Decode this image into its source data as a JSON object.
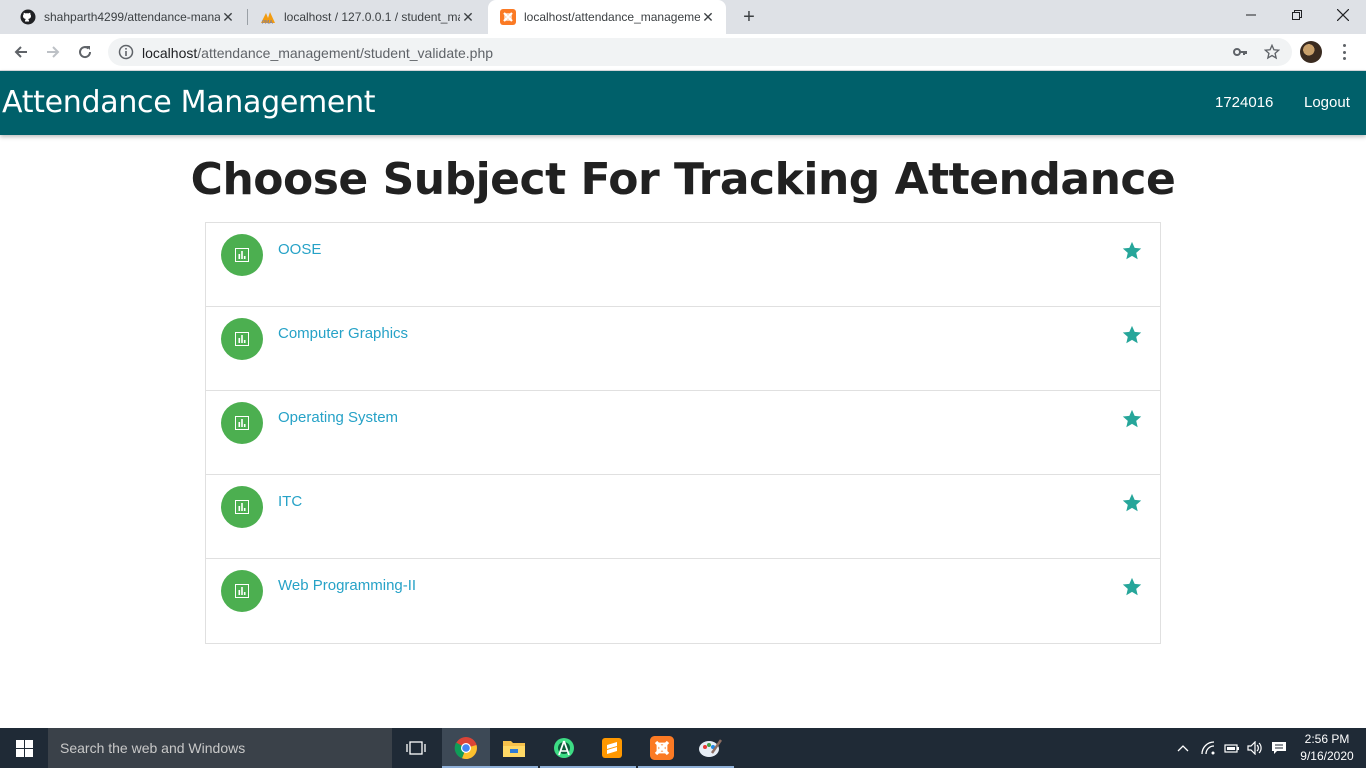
{
  "browser": {
    "tabs": [
      {
        "title": "shahparth4299/attendance-mana",
        "icon": "github-icon"
      },
      {
        "title": "localhost / 127.0.0.1 / student_ma",
        "icon": "phpmyadmin-icon"
      },
      {
        "title": "localhost/attendance_manageme",
        "icon": "xampp-icon",
        "active": true
      }
    ],
    "url_host": "localhost",
    "url_path": "/attendance_management/student_validate.php"
  },
  "navbar": {
    "brand": "Attendance Management",
    "user_id": "1724016",
    "logout_label": "Logout"
  },
  "page": {
    "heading": "Choose Subject For Tracking Attendance",
    "subjects": [
      {
        "name": "OOSE"
      },
      {
        "name": "Computer Graphics"
      },
      {
        "name": "Operating System"
      },
      {
        "name": "ITC"
      },
      {
        "name": "Web Programming-II"
      }
    ]
  },
  "colors": {
    "navbar": "#00606a",
    "subject_link": "#26a2c7",
    "circle": "#4caf50",
    "star": "#26a69a"
  },
  "taskbar": {
    "search_placeholder": "Search the web and Windows",
    "apps": [
      "task-view-icon",
      "chrome-icon",
      "file-explorer-icon",
      "android-studio-icon",
      "sublime-text-icon",
      "xampp-icon",
      "paint-icon"
    ],
    "time": "2:56 PM",
    "date": "9/16/2020"
  }
}
